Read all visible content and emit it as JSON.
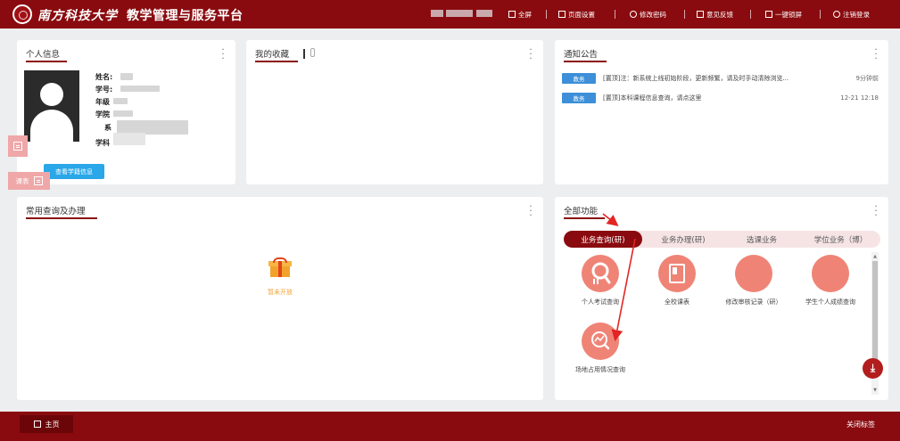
{
  "header": {
    "logo_text": "南方科技大学",
    "app_title": "教学管理与服务平台",
    "toolbar": [
      {
        "icon": "fullscreen-icon",
        "label": "全屏"
      },
      {
        "icon": "shirt-icon",
        "label": "页面设置"
      },
      {
        "icon": "key-icon",
        "label": "修改密码"
      },
      {
        "icon": "feedback-icon",
        "label": "意见反馈"
      },
      {
        "icon": "lock-screen-icon",
        "label": "一键锁屏"
      },
      {
        "icon": "power-icon",
        "label": "注销登录"
      }
    ]
  },
  "profile": {
    "title": "个人信息",
    "labels": {
      "name": "姓名:",
      "student_id": "学号:",
      "grade": "年级",
      "college": "学院",
      "dept": "系",
      "major": "学科"
    },
    "button": "查看学籍信息",
    "schedule_label": "课表"
  },
  "favorites": {
    "title": "我的收藏"
  },
  "notices": {
    "title": "通知公告",
    "items": [
      {
        "tag": "教务",
        "text": "[置顶]注：新系统上线初始阶段，更新频繁，请及时手动清除浏览...",
        "time": "9分钟前"
      },
      {
        "tag": "教务",
        "text": "[置顶]本科课程信息查询，请点这里",
        "time": "12-21 12:18"
      }
    ]
  },
  "common": {
    "title": "常用查询及办理",
    "empty_text": "暂未开放"
  },
  "functions": {
    "title": "全部功能",
    "tabs": [
      {
        "label": "业务查询(研)",
        "active": true
      },
      {
        "label": "业务办理(研)",
        "active": false
      },
      {
        "label": "选课业务",
        "active": false
      },
      {
        "label": "学位业务（博）",
        "active": false
      }
    ],
    "items": [
      {
        "icon": "exam-search-icon",
        "label": "个人考试查询"
      },
      {
        "icon": "book-icon",
        "label": "全校课表"
      },
      {
        "icon": "",
        "label": "修改审核记录（研）"
      },
      {
        "icon": "",
        "label": "学生个人成绩查询"
      },
      {
        "icon": "chart-search-icon",
        "label": "场地占用情况查询"
      }
    ]
  },
  "footer": {
    "home_label": "主页",
    "close_label": "关闭标签"
  },
  "colors": {
    "primary": "#8a0b0f",
    "accent": "#ef8476",
    "tag_blue": "#3c8fd8",
    "button_blue": "#2aa7e8",
    "arrow": "#e32424"
  }
}
